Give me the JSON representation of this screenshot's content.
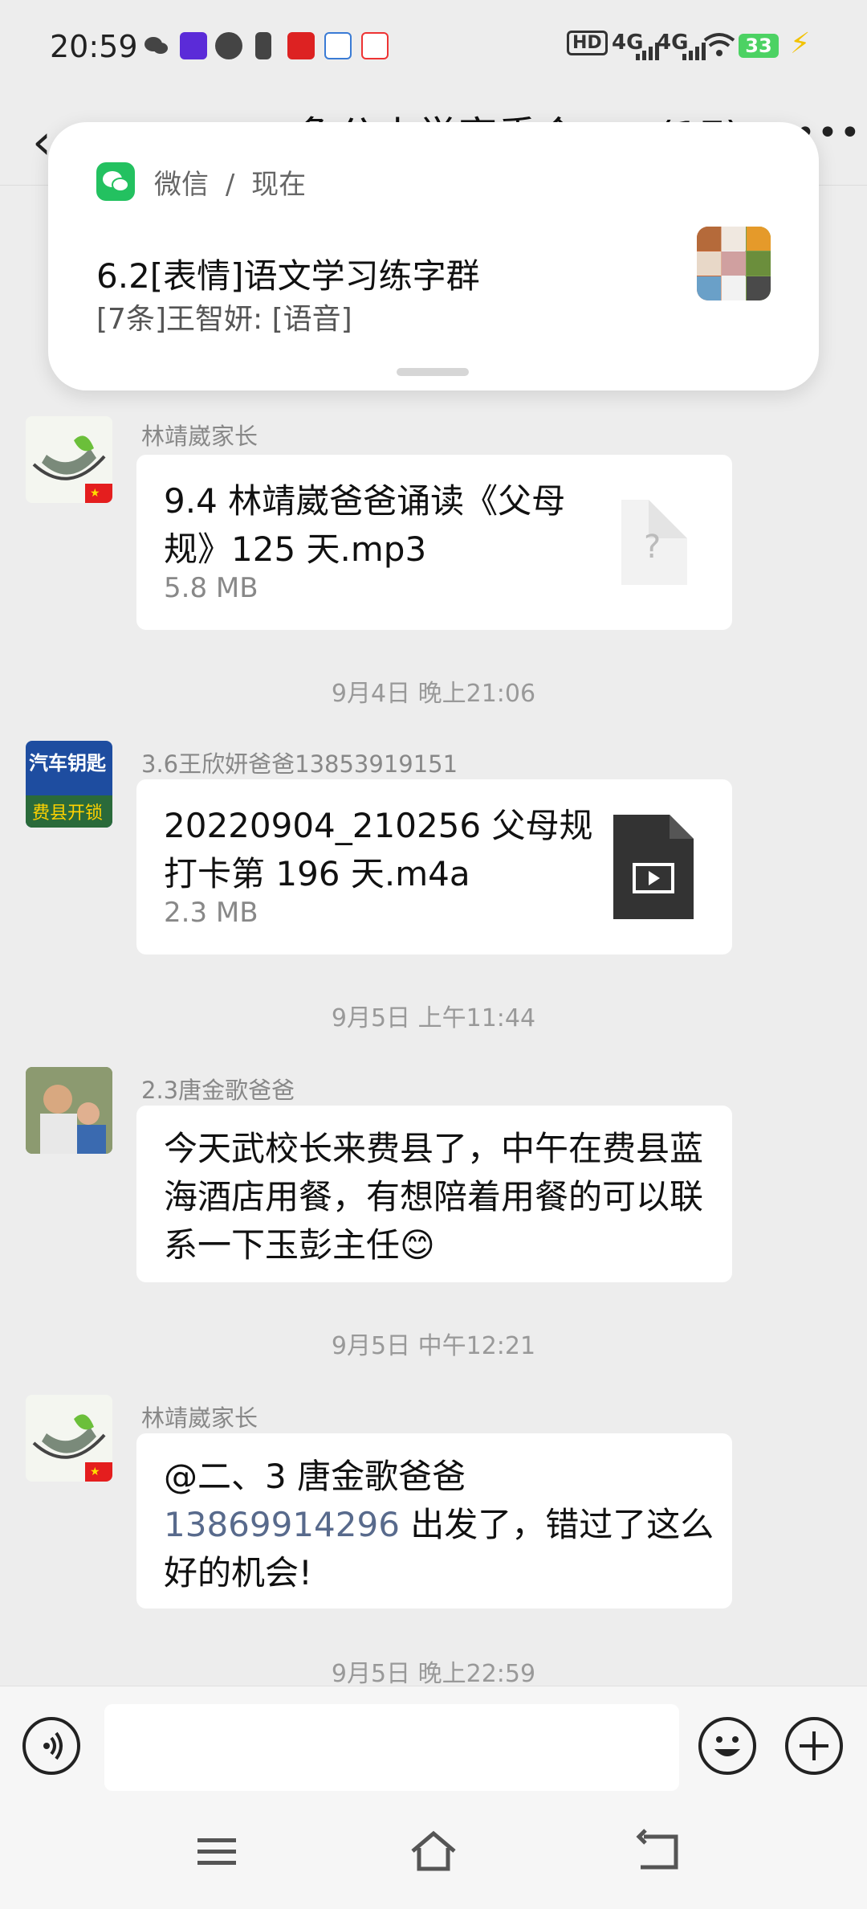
{
  "status_bar": {
    "time": "20:59",
    "network_label": "4G",
    "battery_level": "33",
    "colors": {
      "battery": "#4cd263",
      "bolt": "#f2c200"
    }
  },
  "nav": {
    "back_icon": "chevron-left-icon",
    "title_partial": "……象公小学家委会……(17)",
    "more_icon": "more-dots-icon"
  },
  "notification": {
    "app_name": "微信",
    "separator": "/",
    "time": "现在",
    "title": "6.2[表情]语文学习练字群",
    "body": "[7条]王智妍: [语音]",
    "app_color": "#23c160"
  },
  "messages": [
    {
      "sender": "林靖崴家长",
      "type": "file",
      "file_name": "9.4 林靖崴爸爸诵读《父母规》125 天.mp3",
      "file_size": "5.8 MB",
      "file_icon": "unknown-file-icon",
      "file_icon_glyph": "?"
    },
    {
      "timestamp": "9月4日 晚上21:06"
    },
    {
      "sender": "3.6王欣妍爸爸13853919151",
      "type": "file",
      "file_name": "20220904_210256 父母规打卡第 196 天.m4a",
      "file_size": "2.3 MB",
      "file_icon": "video-file-icon",
      "avatar_text_top": "汽车钥匙",
      "avatar_text_bottom": "费县开锁"
    },
    {
      "timestamp": "9月5日 上午11:44"
    },
    {
      "sender": "2.3唐金歌爸爸",
      "type": "text",
      "text": "今天武校长来费县了，中午在费县蓝海酒店用餐，有想陪着用餐的可以联系一下玉彭主任😊"
    },
    {
      "timestamp": "9月5日 中午12:21"
    },
    {
      "sender": "林靖崴家长",
      "type": "text",
      "text_prefix": "@二、3  唐金歌爸爸",
      "phone": "13869914296",
      "text_suffix": " 出发了，错过了这么好的机会!"
    },
    {
      "timestamp": "9月5日 晚上22:59"
    }
  ],
  "input_bar": {
    "voice_icon": "voice-icon",
    "emoji_icon": "emoji-icon",
    "plus_icon": "plus-icon",
    "placeholder": ""
  },
  "system_nav": {
    "menu_icon": "menu-icon",
    "home_icon": "home-icon",
    "back_icon": "back-icon"
  }
}
